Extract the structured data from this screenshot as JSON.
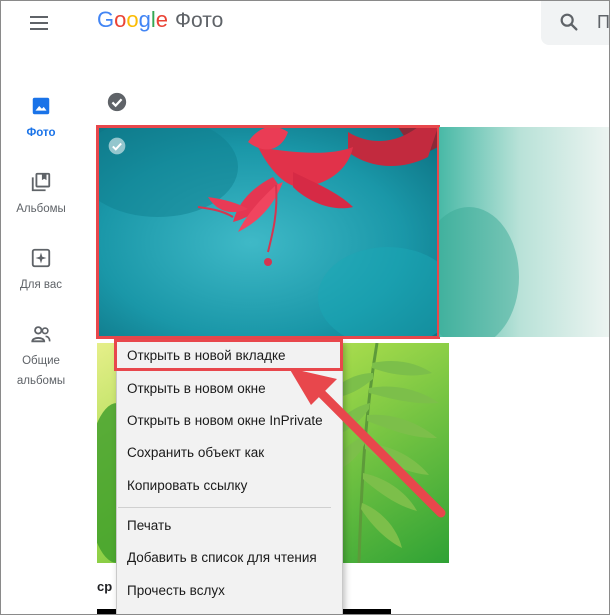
{
  "app": {
    "logo_word": "Google",
    "product_name": "Фото"
  },
  "search": {
    "placeholder": "П"
  },
  "sidebar": {
    "items": [
      {
        "label": "Фото",
        "icon": "photo-icon",
        "active": true
      },
      {
        "label": "Альбомы",
        "icon": "albums-icon",
        "active": false
      },
      {
        "label": "Для вас",
        "icon": "for-you-icon",
        "active": false
      },
      {
        "label": "Общие альбомы",
        "icon": "shared-albums-icon",
        "active": false
      }
    ]
  },
  "gallery": {
    "section_caption": "ср"
  },
  "context_menu": {
    "items": [
      "Открыть в новой вкладке",
      "Открыть в новом окне",
      "Открыть в новом окне InPrivate",
      "Сохранить объект как",
      "Копировать ссылку",
      "Печать",
      "Добавить в список для чтения",
      "Прочесть вслух"
    ]
  },
  "colors": {
    "accent": "#1a73e8",
    "highlight": "#e8474c",
    "menu_bg": "#f2f2f2"
  }
}
